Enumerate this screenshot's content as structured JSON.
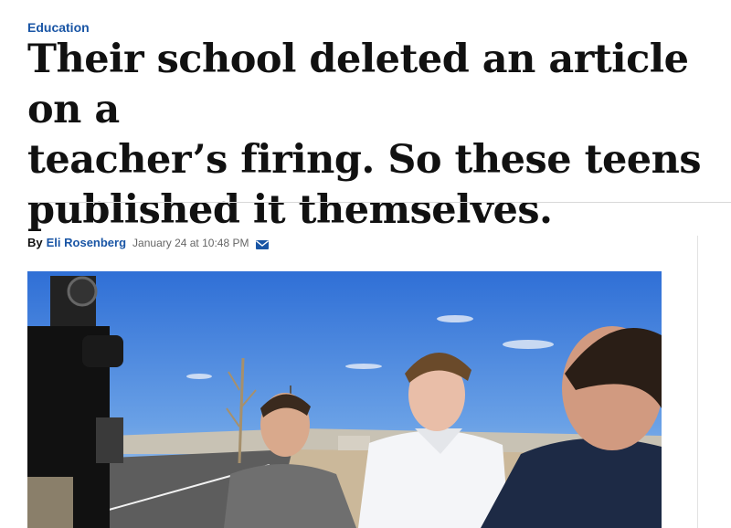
{
  "section": {
    "label": "Education"
  },
  "headline": {
    "line1": "Their school deleted an article on a",
    "line2": "teacher’s firing. So these teens",
    "line3": "published it themselves."
  },
  "byline": {
    "prefix": "By",
    "author": "Eli Rosenberg",
    "timestamp": "January 24 at 10:48 PM",
    "email_icon": "envelope-icon"
  },
  "photo": {
    "subject": "two teenage students interviewed outdoors by a news camera crew"
  },
  "colors": {
    "accent": "#1955a5",
    "headline": "#111111"
  }
}
